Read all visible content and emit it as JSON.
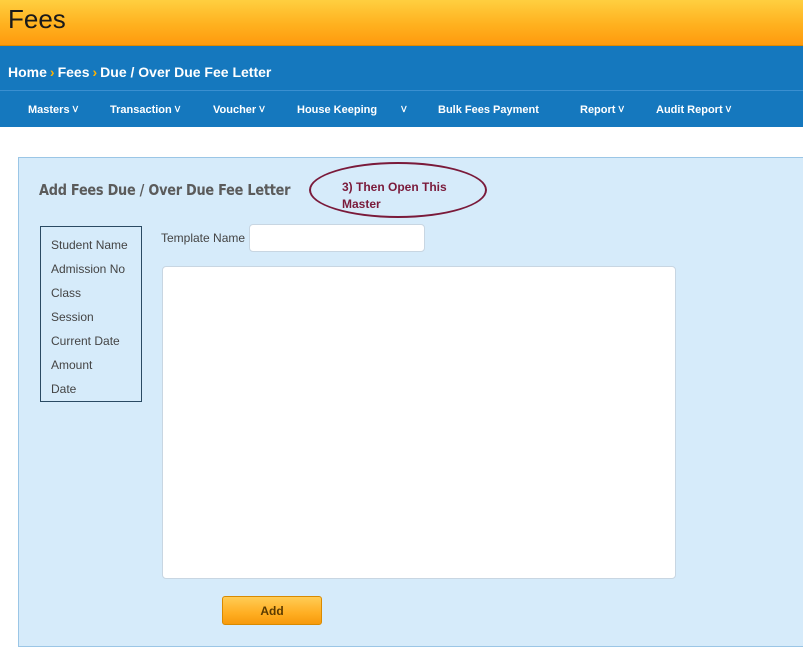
{
  "app": {
    "title": "Fees"
  },
  "breadcrumb": {
    "items": [
      "Home",
      "Fees",
      "Due / Over Due Fee Letter"
    ],
    "separator": "›"
  },
  "nav": {
    "items": [
      {
        "label": "Masters",
        "has_dropdown": true
      },
      {
        "label": "Transaction",
        "has_dropdown": true
      },
      {
        "label": "Voucher",
        "has_dropdown": true
      },
      {
        "label": "House Keeping",
        "has_dropdown": true
      },
      {
        "label": "Bulk Fees Payment",
        "has_dropdown": false
      },
      {
        "label": "Report",
        "has_dropdown": true
      },
      {
        "label": "Audit Report",
        "has_dropdown": true
      }
    ],
    "chevron": "ᐯ"
  },
  "form": {
    "title": "Add Fees Due / Over Due Fee Letter",
    "annotation": "3) Then Open This Master",
    "placeholders": [
      "Student Name",
      "Admission No",
      "Class",
      "Session",
      "Current Date",
      "Amount",
      "Date"
    ],
    "template_name_label": "Template Name",
    "template_name_value": "",
    "body_value": "",
    "add_label": "Add"
  },
  "colors": {
    "header_orange": "#ffb11f",
    "nav_blue": "#1578be",
    "panel_bg": "#d6ebfa",
    "annotation": "#7a1a3a",
    "breadcrumb_separator": "#ffb300"
  }
}
